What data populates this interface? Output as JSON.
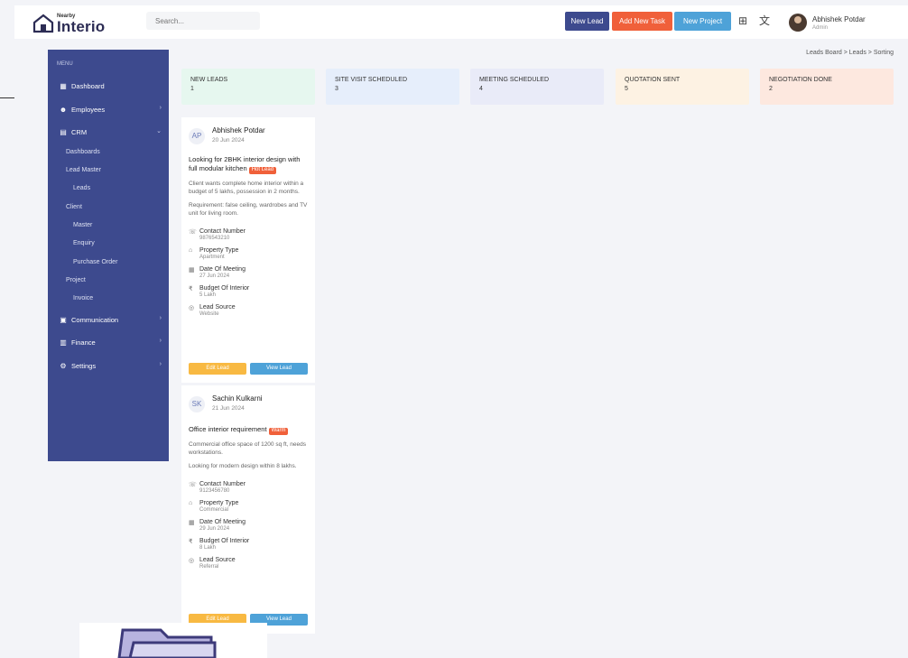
{
  "brand": {
    "top": "Nearby",
    "name": "Interio"
  },
  "search": {
    "placeholder": "Search..."
  },
  "topbar": {
    "new_lead": "New Lead",
    "new_task": "Add New Task",
    "new_project": "New Project",
    "icons": [
      "grid-icon",
      "translate-icon"
    ]
  },
  "user": {
    "name": "Abhishek Potdar",
    "role": "Admin"
  },
  "sidebar": {
    "section": "MENU",
    "items": [
      {
        "label": "Dashboard",
        "icon": "dashboard-icon",
        "chevron": false
      },
      {
        "label": "Employees",
        "icon": "employees-icon",
        "chevron": true
      },
      {
        "label": "CRM",
        "icon": "crm-icon",
        "chevron": true
      }
    ],
    "sub_items": [
      "Dashboards",
      "Lead Master",
      "Leads",
      "Client",
      "Master",
      "Enquiry",
      "Purchase Order",
      "Project",
      "Invoice"
    ],
    "bottom_items": [
      {
        "label": "Communication",
        "icon": "communication-icon"
      },
      {
        "label": "Finance",
        "icon": "finance-icon"
      },
      {
        "label": "Settings",
        "icon": "settings-icon"
      }
    ]
  },
  "breadcrumb": "Leads Board  >  Leads  >  Sorting",
  "stages": [
    {
      "title": "New Leads",
      "count": "1",
      "color": "#e6f7ef"
    },
    {
      "title": "Site Visit Scheduled",
      "count": "3",
      "color": "#e6eefb"
    },
    {
      "title": "Meeting Scheduled",
      "count": "4",
      "color": "#e9ebf8"
    },
    {
      "title": "Quotation Sent",
      "count": "5",
      "color": "#fdf2e3"
    },
    {
      "title": "Negotiation Done",
      "count": "2",
      "color": "#fde8df"
    }
  ],
  "leads": [
    {
      "avatar": "AP",
      "name": "Abhishek Potdar",
      "date": "20 Jun 2024",
      "subject": "Looking for 2BHK interior design with full modular kitchen",
      "badge": "Hot Lead",
      "paragraphs": [
        "Client wants complete home interior within a budget of 5 lakhs, possession in 2 months.",
        "Requirement: false ceiling, wardrobes and TV unit for living room."
      ],
      "fields": [
        {
          "label": "Contact Number",
          "value": "9876543210"
        },
        {
          "label": "Property Type",
          "value": "Apartment"
        },
        {
          "label": "Date Of Meeting",
          "value": "27 Jun 2024"
        },
        {
          "label": "Budget Of Interior",
          "value": "5 Lakh"
        },
        {
          "label": "Lead Source",
          "value": "Website"
        }
      ],
      "btn_edit": "Edit Lead",
      "btn_view": "View Lead"
    },
    {
      "avatar": "SK",
      "name": "Sachin Kulkarni",
      "date": "21 Jun 2024",
      "subject": "Office interior requirement",
      "badge": "Warm",
      "paragraphs": [
        "Commercial office space of 1200 sq ft, needs workstations.",
        "Looking for modern design within 8 lakhs."
      ],
      "fields": [
        {
          "label": "Contact Number",
          "value": "9123456780"
        },
        {
          "label": "Property Type",
          "value": "Commercial"
        },
        {
          "label": "Date Of Meeting",
          "value": "29 Jun 2024"
        },
        {
          "label": "Budget Of Interior",
          "value": "8 Lakh"
        },
        {
          "label": "Lead Source",
          "value": "Referral"
        }
      ],
      "btn_edit": "Edit Lead",
      "btn_view": "View Lead"
    }
  ]
}
